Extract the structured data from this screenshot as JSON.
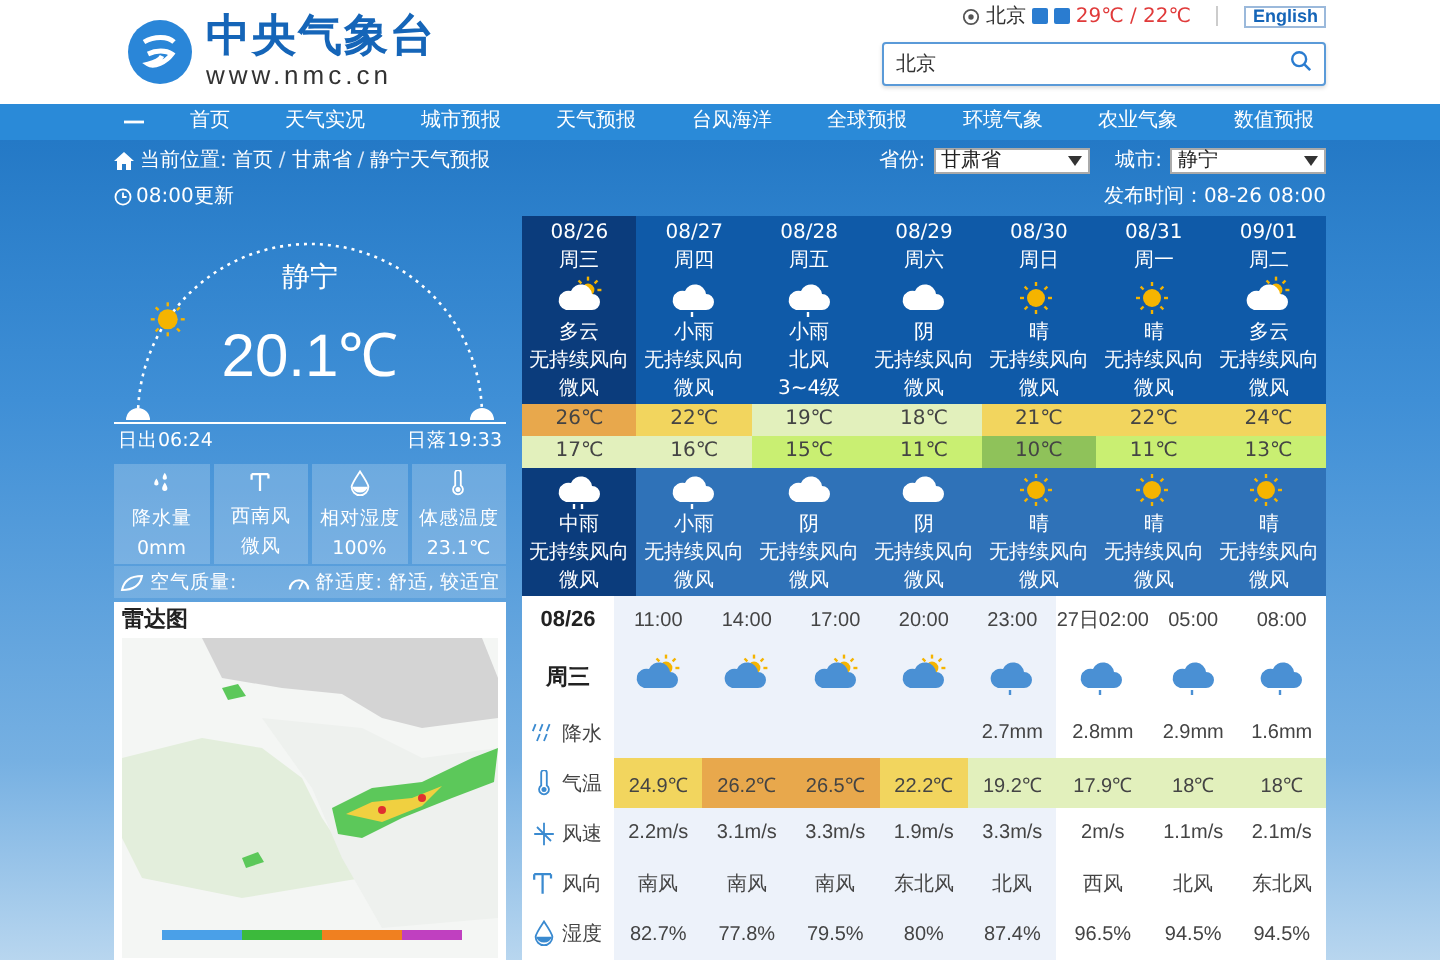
{
  "header": {
    "site_title": "中央气象台",
    "site_url": "www.nmc.cn",
    "city": "北京",
    "temps": "29℃ / 22℃",
    "language": "English",
    "search": {
      "value": "北京"
    }
  },
  "nav": [
    "首页",
    "天气实况",
    "城市预报",
    "天气预报",
    "台风海洋",
    "全球预报",
    "环境气象",
    "农业气象",
    "数值预报"
  ],
  "breadcrumb": {
    "label": "当前位置:",
    "separator": "/",
    "items": [
      "首页",
      "甘肃省",
      "静宁天气预报"
    ]
  },
  "selectors": [
    {
      "label": "省份:",
      "value": "甘肃省"
    },
    {
      "label": "城市:",
      "value": "静宁"
    }
  ],
  "update_time": "08:00更新",
  "publish_time": "发布时间：08-26 08:00",
  "current": {
    "city": "静宁",
    "temperature": "20.1℃",
    "sunrise": "日出06:24",
    "sunset": "日落19:33",
    "sun_arc": {
      "level": 0.19
    },
    "stats": [
      {
        "kind": "precipitation",
        "label": "降水量",
        "value": "0mm"
      },
      {
        "kind": "wind",
        "label": "西南风",
        "value": "微风"
      },
      {
        "kind": "humidity",
        "label": "相对湿度",
        "value": "100%"
      },
      {
        "kind": "feels_like",
        "label": "体感温度",
        "value": "23.1℃"
      }
    ],
    "air_quality": "空气质量:",
    "comfort": "舒适度: 舒适, 较适宜"
  },
  "radar": {
    "title": "雷达图"
  },
  "days": [
    {
      "date": "08/26",
      "weekday": "周三",
      "selected": true,
      "day": {
        "kind": "partly_cloudy",
        "weather": "多云",
        "wind_dir": "无持续风向",
        "wind_level": "微风"
      },
      "high": {
        "text": "26℃",
        "color": "#e8a84c"
      },
      "low": {
        "text": "17℃",
        "color": "#e2f0bc"
      },
      "night": {
        "kind": "moderate_rain",
        "weather": "中雨",
        "wind_dir": "无持续风向",
        "wind_level": "微风"
      }
    },
    {
      "date": "08/27",
      "weekday": "周四",
      "selected": false,
      "day": {
        "kind": "light_rain",
        "weather": "小雨",
        "wind_dir": "无持续风向",
        "wind_level": "微风"
      },
      "high": {
        "text": "22℃",
        "color": "#f2d55e"
      },
      "low": {
        "text": "16℃",
        "color": "#e2f0bc"
      },
      "night": {
        "kind": "light_rain",
        "weather": "小雨",
        "wind_dir": "无持续风向",
        "wind_level": "微风"
      }
    },
    {
      "date": "08/28",
      "weekday": "周五",
      "selected": false,
      "day": {
        "kind": "light_rain",
        "weather": "小雨",
        "wind_dir": "北风",
        "wind_level": "3~4级"
      },
      "high": {
        "text": "19℃",
        "color": "#e2f0bc"
      },
      "low": {
        "text": "15℃",
        "color": "#c9ef72"
      },
      "night": {
        "kind": "cloudy",
        "weather": "阴",
        "wind_dir": "无持续风向",
        "wind_level": "微风"
      }
    },
    {
      "date": "08/29",
      "weekday": "周六",
      "selected": false,
      "day": {
        "kind": "cloudy",
        "weather": "阴",
        "wind_dir": "无持续风向",
        "wind_level": "微风"
      },
      "high": {
        "text": "18℃",
        "color": "#e2f0bc"
      },
      "low": {
        "text": "11℃",
        "color": "#c9ef72"
      },
      "night": {
        "kind": "cloudy",
        "weather": "阴",
        "wind_dir": "无持续风向",
        "wind_level": "微风"
      }
    },
    {
      "date": "08/30",
      "weekday": "周日",
      "selected": false,
      "day": {
        "kind": "sunny",
        "weather": "晴",
        "wind_dir": "无持续风向",
        "wind_level": "微风"
      },
      "high": {
        "text": "21℃",
        "color": "#f2d55e"
      },
      "low": {
        "text": "10℃",
        "color": "#8fc25a"
      },
      "night": {
        "kind": "sunny",
        "weather": "晴",
        "wind_dir": "无持续风向",
        "wind_level": "微风"
      }
    },
    {
      "date": "08/31",
      "weekday": "周一",
      "selected": false,
      "day": {
        "kind": "sunny",
        "weather": "晴",
        "wind_dir": "无持续风向",
        "wind_level": "微风"
      },
      "high": {
        "text": "22℃",
        "color": "#f2d55e"
      },
      "low": {
        "text": "11℃",
        "color": "#c9ef72"
      },
      "night": {
        "kind": "sunny",
        "weather": "晴",
        "wind_dir": "无持续风向",
        "wind_level": "微风"
      }
    },
    {
      "date": "09/01",
      "weekday": "周二",
      "selected": false,
      "day": {
        "kind": "partly_cloudy",
        "weather": "多云",
        "wind_dir": "无持续风向",
        "wind_level": "微风"
      },
      "high": {
        "text": "24℃",
        "color": "#f2d55e"
      },
      "low": {
        "text": "13℃",
        "color": "#c9ef72"
      },
      "night": {
        "kind": "sunny",
        "weather": "晴",
        "wind_dir": "无持续风向",
        "wind_level": "微风"
      }
    }
  ],
  "hourly": {
    "date": "08/26",
    "weekday": "周三",
    "times": [
      {
        "time": "11:00",
        "kind": "partly_cloudy",
        "today": true
      },
      {
        "time": "14:00",
        "kind": "partly_cloudy",
        "today": true
      },
      {
        "time": "17:00",
        "kind": "partly_cloudy",
        "today": true
      },
      {
        "time": "20:00",
        "kind": "partly_cloudy",
        "today": true
      },
      {
        "time": "23:00",
        "kind": "light_rain",
        "today": true
      },
      {
        "time": "27日02:00",
        "kind": "light_rain",
        "today": false
      },
      {
        "time": "05:00",
        "kind": "light_rain",
        "today": false
      },
      {
        "time": "08:00",
        "kind": "light_rain",
        "today": false
      }
    ],
    "rows": [
      {
        "kind": "precipitation",
        "label": "降水",
        "cells": [
          null,
          null,
          null,
          null,
          "2.7mm",
          "2.8mm",
          "2.9mm",
          "1.6mm"
        ]
      },
      {
        "kind": "temperature",
        "label": "气温",
        "cells": [
          {
            "text": "24.9℃",
            "color": "#f2d55e"
          },
          {
            "text": "26.2℃",
            "color": "#e8a84c"
          },
          {
            "text": "26.5℃",
            "color": "#e8a84c"
          },
          {
            "text": "22.2℃",
            "color": "#f2d55e"
          },
          {
            "text": "19.2℃",
            "color": "#e2f0bc"
          },
          {
            "text": "17.9℃",
            "color": "#e2f0bc"
          },
          {
            "text": "18℃",
            "color": "#e2f0bc"
          },
          {
            "text": "18℃",
            "color": "#e2f0bc"
          }
        ]
      },
      {
        "kind": "wind_speed",
        "label": "风速",
        "cells": [
          "2.2m/s",
          "3.1m/s",
          "3.3m/s",
          "1.9m/s",
          "3.3m/s",
          "2m/s",
          "1.1m/s",
          "2.1m/s"
        ]
      },
      {
        "kind": "wind_dir",
        "label": "风向",
        "cells": [
          "南风",
          "南风",
          "南风",
          "东北风",
          "北风",
          "西风",
          "北风",
          "东北风"
        ]
      },
      {
        "kind": "humidity",
        "label": "湿度",
        "cells": [
          "82.7%",
          "77.8%",
          "79.5%",
          "80%",
          "87.4%",
          "96.5%",
          "94.5%",
          "94.5%"
        ]
      }
    ]
  }
}
